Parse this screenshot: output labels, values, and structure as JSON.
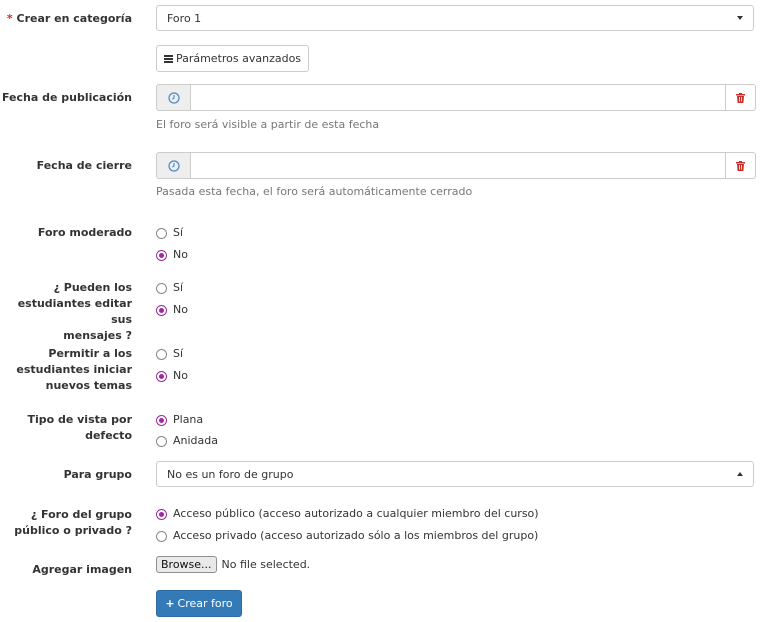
{
  "form": {
    "category": {
      "required_mark": "*",
      "label": "Crear en categoría",
      "value": "Foro 1"
    },
    "advanced_button": "Parámetros avanzados",
    "publication_date": {
      "label": "Fecha de publicación",
      "value": "",
      "help": "El foro será visible a partir de esta fecha"
    },
    "closing_date": {
      "label": "Fecha de cierre",
      "value": "",
      "help": "Pasada esta fecha, el foro será automáticamente cerrado"
    },
    "moderated": {
      "label": "Foro moderado",
      "options": [
        "Sí",
        "No"
      ],
      "selected": "No"
    },
    "students_edit": {
      "label": "¿ Pueden los estudiantes editar sus mensajes ?",
      "label_lines": [
        "¿ Pueden los",
        "estudiantes editar sus",
        "mensajes ?"
      ],
      "options": [
        "Sí",
        "No"
      ],
      "selected": "No"
    },
    "students_new_topics": {
      "label_lines": [
        "Permitir a los",
        "estudiantes iniciar",
        "nuevos temas"
      ],
      "options": [
        "Sí",
        "No"
      ],
      "selected": "No"
    },
    "default_view": {
      "label_lines": [
        "Tipo de vista por",
        "defecto"
      ],
      "options": [
        "Plana",
        "Anidada"
      ],
      "selected": "Plana"
    },
    "group": {
      "label": "Para grupo",
      "value": "No es un foro de grupo"
    },
    "group_visibility": {
      "label_lines": [
        "¿ Foro del grupo",
        "público o privado ?"
      ],
      "options": [
        "Acceso público (acceso autorizado a cualquier miembro del curso)",
        "Acceso privado (acceso autorizado sólo a los miembros del grupo)"
      ],
      "selected": "Acceso público (acceso autorizado a cualquier miembro del curso)"
    },
    "image": {
      "label": "Agregar imagen",
      "browse_label": "Browse...",
      "status": "No file selected."
    },
    "submit_label": "Crear foro"
  },
  "colors": {
    "accent": "#9b2b9b",
    "primary_button": "#337ab7",
    "delete_icon": "#c9302c",
    "clock_icon": "#4a88c8"
  },
  "icons": {
    "advanced": "bars-icon",
    "date": "clock-icon",
    "clear": "trash-icon",
    "submit": "plus-icon"
  }
}
